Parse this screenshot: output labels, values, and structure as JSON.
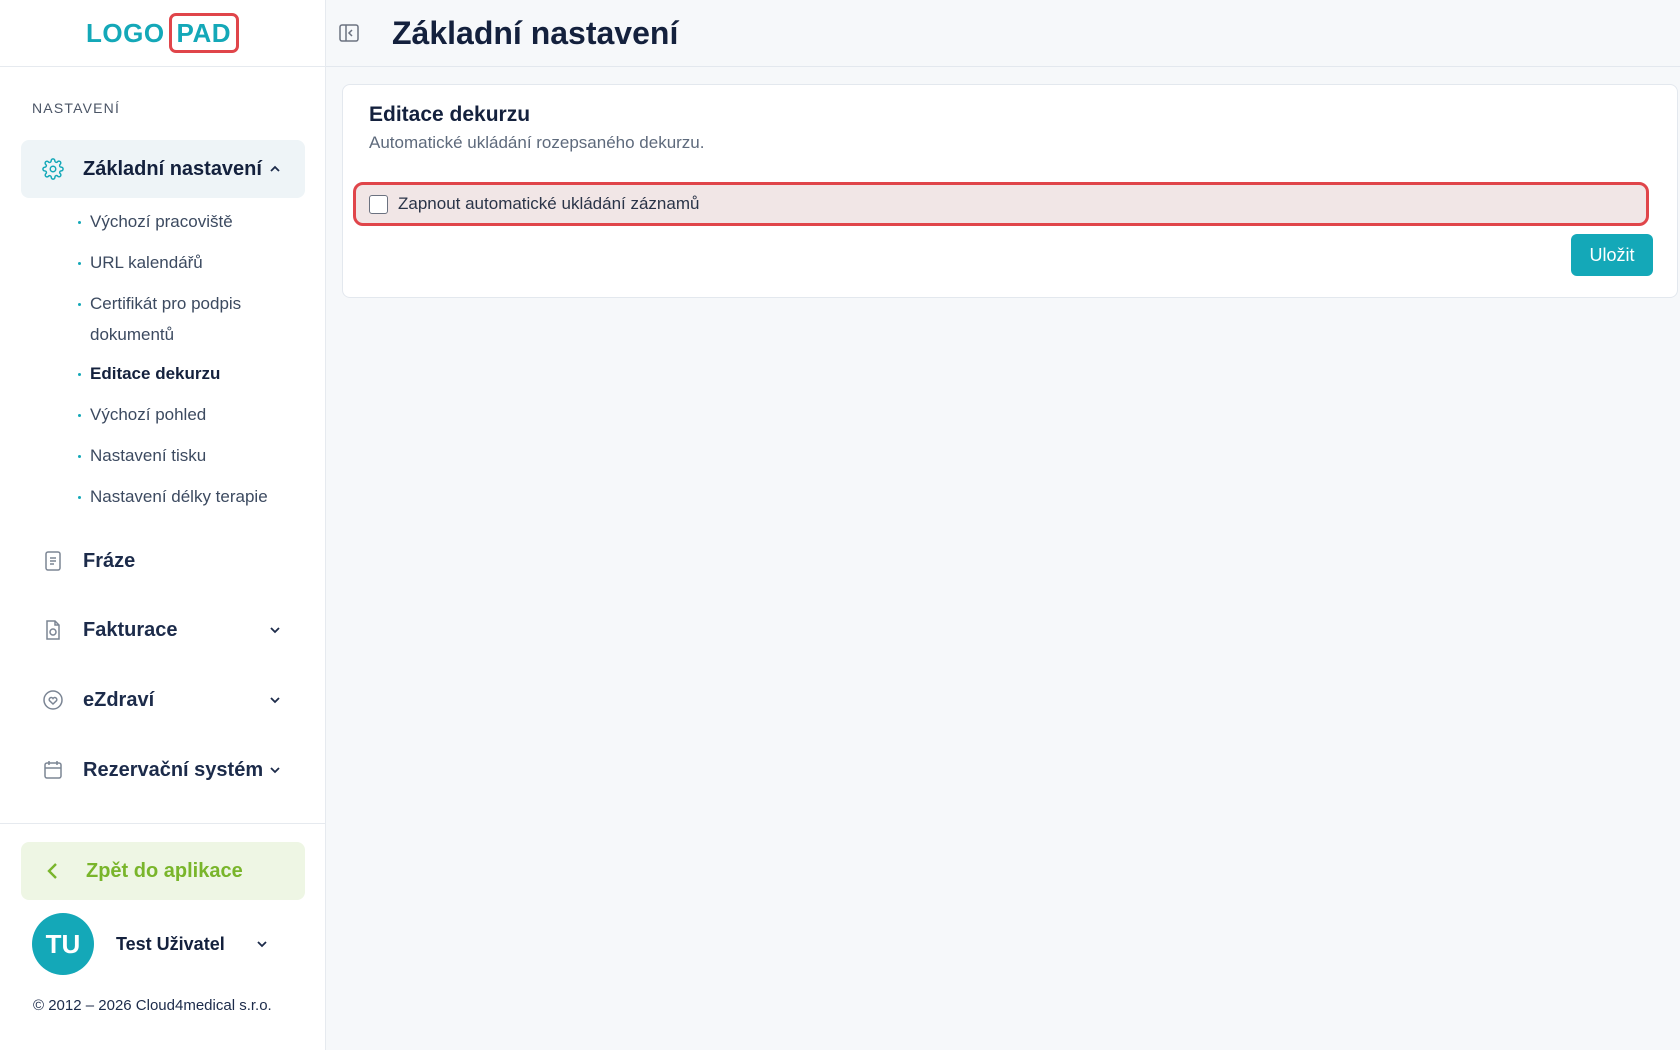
{
  "brand": {
    "logo_left": "LOGO",
    "logo_right": "PAD",
    "accent": "#14a8b8",
    "highlight": "#e0454a"
  },
  "sidebar": {
    "section_title": "NASTAVENÍ",
    "items": [
      {
        "label": "Základní nastavení",
        "icon": "gear-icon",
        "expanded": true,
        "subitems": [
          "Výchozí pracoviště",
          "URL kalendářů",
          "Certifikát pro podpis dokumentů",
          "Editace dekurzu",
          "Výchozí pohled",
          "Nastavení tisku",
          "Nastavení délky terapie"
        ],
        "current_subitem": "Editace dekurzu"
      },
      {
        "label": "Fráze",
        "icon": "document-icon"
      },
      {
        "label": "Fakturace",
        "icon": "invoice-icon"
      },
      {
        "label": "eZdraví",
        "icon": "heart-icon"
      },
      {
        "label": "Rezervační systém",
        "icon": "calendar-icon"
      }
    ],
    "back_label": "Zpět do aplikace",
    "back_color": "#79b52b",
    "user": {
      "initials": "TU",
      "name": "Test Uživatel"
    },
    "copyright": "© 2012 – 2026 Cloud4medical s.r.o."
  },
  "header": {
    "title": "Základní nastavení"
  },
  "card": {
    "title": "Editace dekurzu",
    "subtitle": "Automatické ukládání rozepsaného dekurzu.",
    "option_label": "Zapnout automatické ukládání záznamů",
    "option_checked": false,
    "save_label": "Uložit"
  }
}
